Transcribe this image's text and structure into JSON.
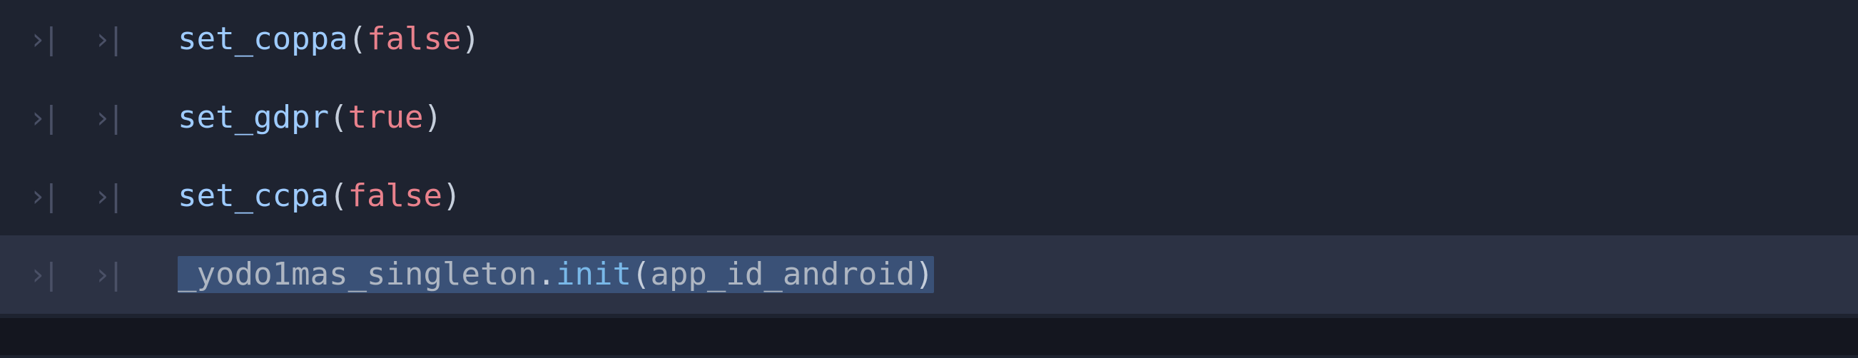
{
  "editor": {
    "indent_glyph": "›|",
    "lines": [
      {
        "func": "set_coppa",
        "arg": "false",
        "highlighted": false
      },
      {
        "func": "set_gdpr",
        "arg": "true",
        "highlighted": false
      },
      {
        "func": "set_ccpa",
        "arg": "false",
        "highlighted": false
      }
    ],
    "line4": {
      "obj": "_yodo1mas_singleton",
      "method": "init",
      "arg": "app_id_android",
      "highlighted": true
    }
  }
}
